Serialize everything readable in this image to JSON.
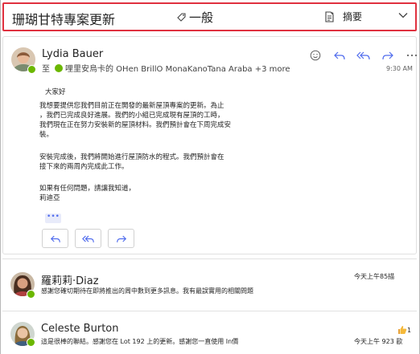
{
  "header": {
    "title": "珊瑚甘特專案更新",
    "category": "一般",
    "summary_label": "摘要"
  },
  "message1": {
    "sender": "Lydia Bauer",
    "to_label": "至",
    "recipients": "哩里安烏卡的 OHen BrillO MonaKanoTana Araba +3 more",
    "time": "9:30 AM",
    "body": [
      "大家好",
      "我想要提供您我們目前正在開發的最新屋頂專案的更新。為止",
      "，我們已完成良好進展。我們的小組已完成現有屋頂的工時，",
      "我們現在正在努力安裝新的屋頂材料。我們預計會在下周完成安",
      "裝。",
      "安裝完成後，我們將開始進行屋頂防水的程式。我們預計會在",
      "接下來的兩周內完成此工作。",
      "如果有任何問題，請讓我知道，",
      "莉迪亞"
    ],
    "more_dots": "•••"
  },
  "message2": {
    "sender": "羅莉莉·Diaz",
    "time": "今天上午85描",
    "preview": "感謝您確切期待在即將推出的周中數到更多訊息。我有最誤實用的相關問題"
  },
  "message3": {
    "sender": "Celeste Burton",
    "count": "1",
    "preview": "這是很棒的聯結。感謝您在 Lot 192 上的更新。感謝您一直使用 In價",
    "time": "今天上午 923 歐"
  },
  "colors": {
    "accent": "#4f6bed",
    "header_border": "#e0313f",
    "presence": "#6bb700"
  }
}
